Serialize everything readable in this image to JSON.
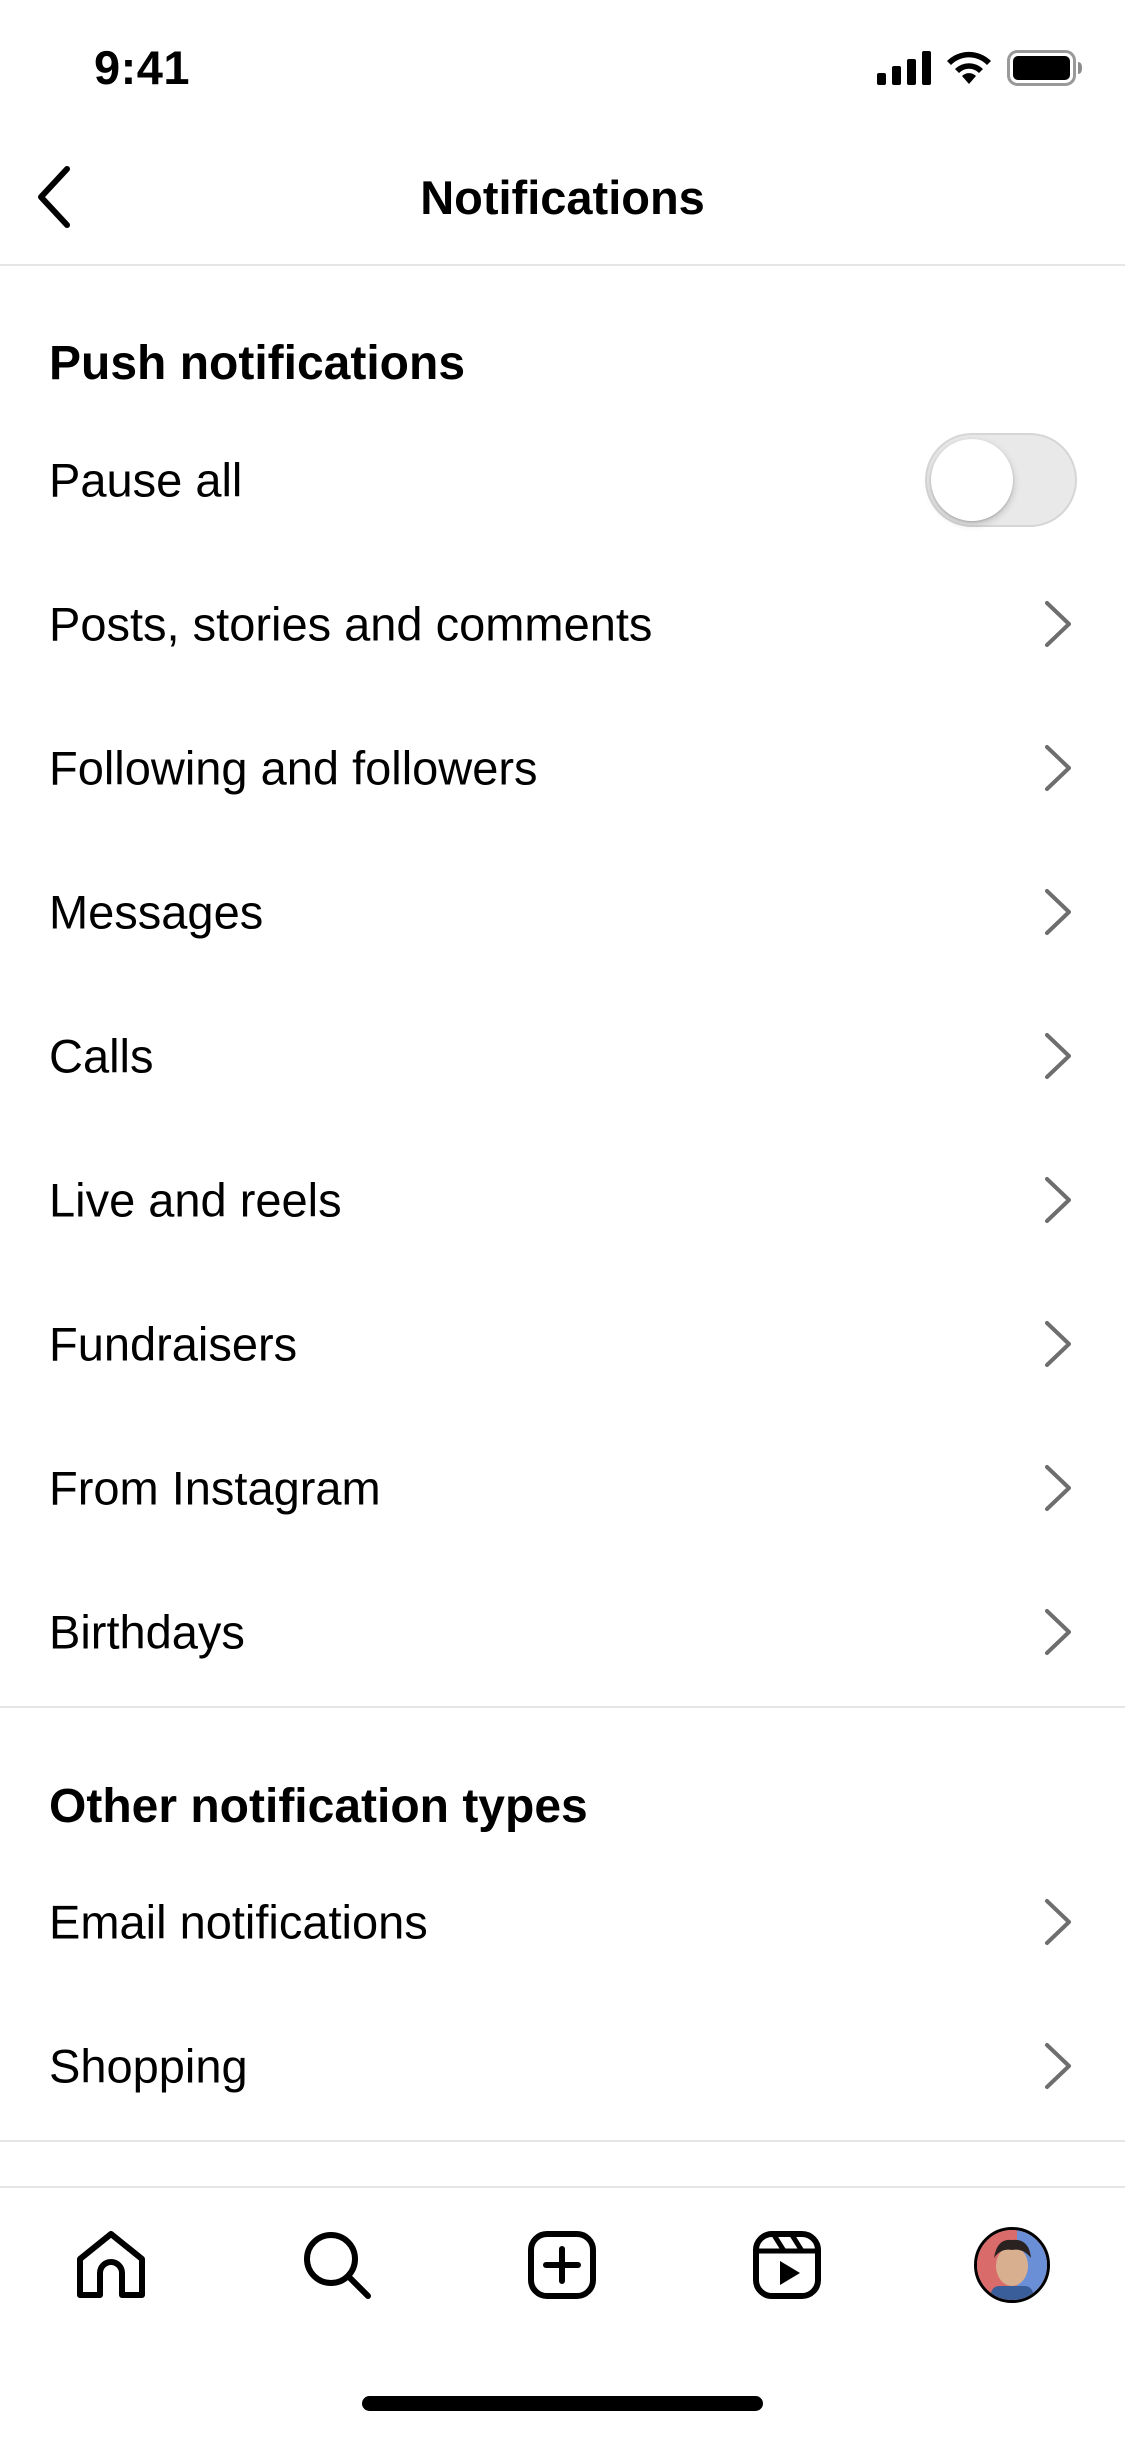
{
  "status_bar": {
    "time": "9:41"
  },
  "nav": {
    "title": "Notifications",
    "back_icon": "chevron-left-icon"
  },
  "sections": [
    {
      "header": "Push notifications",
      "items": [
        {
          "label": "Pause all",
          "type": "toggle",
          "on": false
        },
        {
          "label": "Posts, stories and comments",
          "type": "link"
        },
        {
          "label": "Following and followers",
          "type": "link"
        },
        {
          "label": "Messages",
          "type": "link"
        },
        {
          "label": "Calls",
          "type": "link"
        },
        {
          "label": "Live and reels",
          "type": "link"
        },
        {
          "label": "Fundraisers",
          "type": "link"
        },
        {
          "label": "From Instagram",
          "type": "link"
        },
        {
          "label": "Birthdays",
          "type": "link"
        }
      ]
    },
    {
      "header": "Other notification types",
      "items": [
        {
          "label": "Email notifications",
          "type": "link"
        },
        {
          "label": "Shopping",
          "type": "link"
        }
      ]
    }
  ],
  "tab_bar": {
    "tabs": [
      {
        "name": "home",
        "icon": "home-icon"
      },
      {
        "name": "search",
        "icon": "search-icon"
      },
      {
        "name": "create",
        "icon": "plus-square-icon"
      },
      {
        "name": "reels",
        "icon": "reels-icon"
      },
      {
        "name": "profile",
        "icon": "avatar"
      }
    ]
  },
  "colors": {
    "text": "#000000",
    "divider": "#e6e6e6",
    "chevron": "#6e6e6e",
    "toggle_off": "#e9e9ea"
  }
}
